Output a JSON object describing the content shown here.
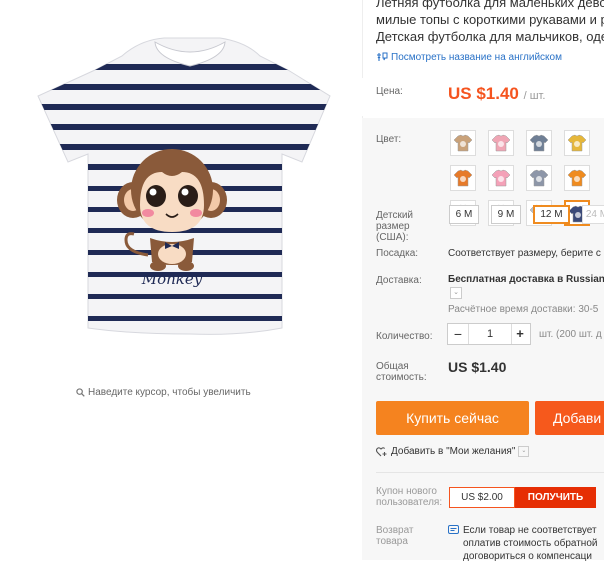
{
  "product": {
    "title_lines": [
      "Летняя футболка для маленьких девоч",
      "милые топы с короткими рукавами и р",
      "Детская футболка для мальчиков, оде"
    ],
    "translate_link": "Посмотреть название на английском"
  },
  "image": {
    "zoom_hint": "Наведите курсор, чтобы увеличить",
    "print_text": "Monkey"
  },
  "price": {
    "label": "Цена:",
    "value": "US $1.40",
    "unit": "/ шт."
  },
  "color": {
    "label": "Цвет:",
    "swatches": [
      {
        "name": "white-brown-bear",
        "accent": "#c9a27a",
        "selected": false
      },
      {
        "name": "pink-cartoon",
        "accent": "#f0a6b5",
        "selected": false
      },
      {
        "name": "grey-cat",
        "accent": "#6f7f95",
        "selected": false
      },
      {
        "name": "yellow-bear",
        "accent": "#e6b73a",
        "selected": false
      },
      {
        "name": "white-fox",
        "accent": "#e67a2a",
        "selected": false
      },
      {
        "name": "pink-bunny",
        "accent": "#f4a1b8",
        "selected": false
      },
      {
        "name": "grey-monkey",
        "accent": "#8d96a8",
        "selected": false
      },
      {
        "name": "orange-fox",
        "accent": "#ef8b1f",
        "selected": false
      },
      {
        "name": "white-panda",
        "accent": "#3b4c75",
        "selected": false
      },
      {
        "name": "pink-pig",
        "accent": "#f7b6b6",
        "selected": false
      },
      {
        "name": "grey-cat-2",
        "accent": "#b9bfc9",
        "selected": false
      },
      {
        "name": "striped-monkey",
        "accent": "#3b4a78",
        "selected": true
      }
    ]
  },
  "size": {
    "label": "Детский размер (США):",
    "options": [
      {
        "label": "6 M",
        "state": "normal"
      },
      {
        "label": "9 M",
        "state": "normal"
      },
      {
        "label": "12 M",
        "state": "selected"
      },
      {
        "label": "24 M",
        "state": "disabled"
      }
    ]
  },
  "fit": {
    "label": "Посадка:",
    "value": "Соответствует размеру, берите с"
  },
  "shipping": {
    "label": "Доставка:",
    "value": "Бесплатная доставка в Russian",
    "time": "Расчётное время доставки: 30-5"
  },
  "quantity": {
    "label": "Количество:",
    "value": "1",
    "note": "шт. (200 шт. д"
  },
  "total": {
    "label": "Общая стоимость:",
    "value": "US $1.40"
  },
  "buttons": {
    "buy_now": "Купить сейчас",
    "add_to_cart": "Добави"
  },
  "wishlist": {
    "label": "Добавить в \"Мои желания\""
  },
  "coupon": {
    "label": "Купон нового пользователя:",
    "value": "US $2.00",
    "button": "ПОЛУЧИТЬ"
  },
  "returns": {
    "label": "Возврат товара",
    "lines": [
      "Если товар не соответствует",
      "оплатив стоимость обратной",
      "договориться о компенсаци"
    ]
  },
  "colors": {
    "accent": "#f5541f",
    "buy": "#f5831f",
    "cart": "#f6591c",
    "link": "#2a72c7",
    "selected_border": "#ef8b1f"
  }
}
